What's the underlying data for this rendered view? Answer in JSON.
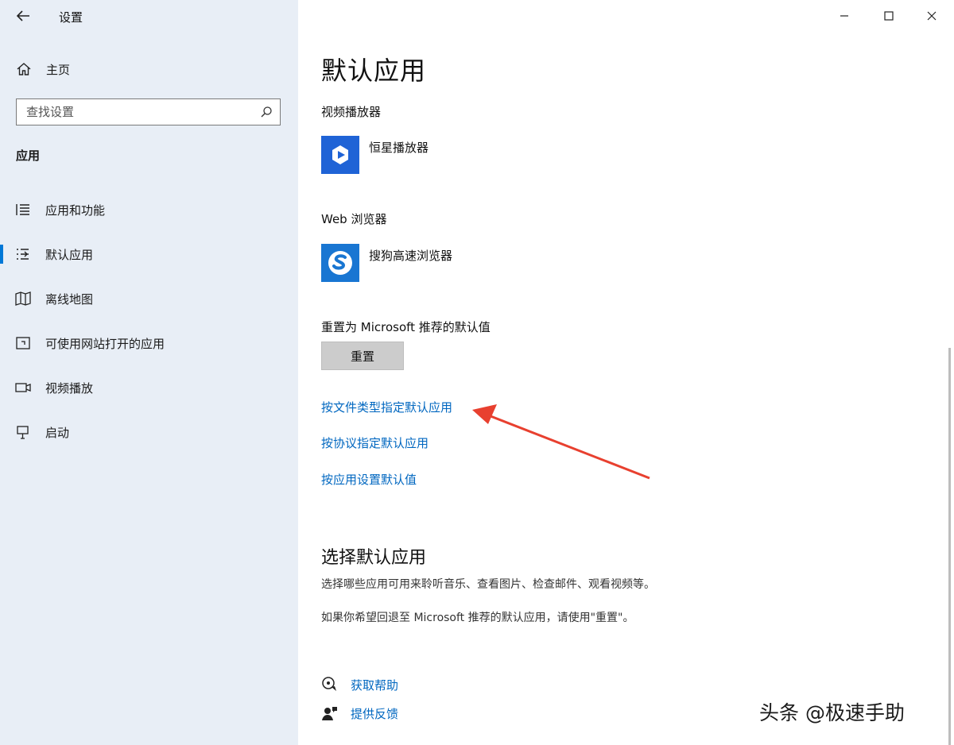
{
  "window": {
    "title": "设置",
    "controls": {
      "minimize": "minimize",
      "maximize": "maximize",
      "close": "close"
    }
  },
  "sidebar": {
    "home_label": "主页",
    "search_placeholder": "查找设置",
    "section_heading": "应用",
    "items": [
      {
        "label": "应用和功能",
        "icon": "apps-features-icon",
        "selected": false
      },
      {
        "label": "默认应用",
        "icon": "default-apps-icon",
        "selected": true
      },
      {
        "label": "离线地图",
        "icon": "offline-maps-icon",
        "selected": false
      },
      {
        "label": "可使用网站打开的应用",
        "icon": "apps-for-websites-icon",
        "selected": false
      },
      {
        "label": "视频播放",
        "icon": "video-playback-icon",
        "selected": false
      },
      {
        "label": "启动",
        "icon": "startup-icon",
        "selected": false
      }
    ],
    "accent_color": "#0078d7"
  },
  "main": {
    "title": "默认应用",
    "video_player": {
      "label": "视频播放器",
      "app_name": "恒星播放器",
      "tile_color": "#1f63d6"
    },
    "web_browser": {
      "label": "Web 浏览器",
      "app_name": "搜狗高速浏览器",
      "tile_color": "#1976d2"
    },
    "reset": {
      "label": "重置为 Microsoft 推荐的默认值",
      "button": "重置"
    },
    "links": [
      "按文件类型指定默认应用",
      "按协议指定默认应用",
      "按应用设置默认值"
    ],
    "choose_section": {
      "title": "选择默认应用",
      "description": "选择哪些应用可用来聆听音乐、查看图片、检查邮件、观看视频等。",
      "reset_hint": "如果你希望回退至 Microsoft 推荐的默认应用，请使用\"重置\"。"
    },
    "help": {
      "get_help": "获取帮助",
      "feedback": "提供反馈"
    },
    "link_color": "#0067c0",
    "arrow_color": "#e8402f"
  },
  "watermark": "头条 @极速手助"
}
